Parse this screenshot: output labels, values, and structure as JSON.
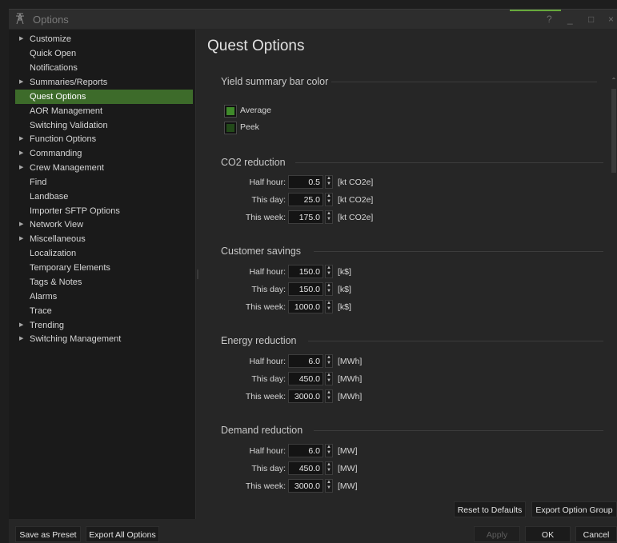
{
  "window": {
    "title": "Options",
    "controls": {
      "help": "?",
      "minimize": "_",
      "maximize": "□",
      "close": "×"
    }
  },
  "sidebar": {
    "items": [
      {
        "label": "Customize",
        "expandable": true
      },
      {
        "label": "Quick Open",
        "expandable": false
      },
      {
        "label": "Notifications",
        "expandable": false
      },
      {
        "label": "Summaries/Reports",
        "expandable": true
      },
      {
        "label": "Quest Options",
        "expandable": false,
        "selected": true
      },
      {
        "label": "AOR Management",
        "expandable": false
      },
      {
        "label": "Switching Validation",
        "expandable": false
      },
      {
        "label": "Function Options",
        "expandable": true
      },
      {
        "label": "Commanding",
        "expandable": true
      },
      {
        "label": "Crew Management",
        "expandable": true
      },
      {
        "label": "Find",
        "expandable": false
      },
      {
        "label": "Landbase",
        "expandable": false
      },
      {
        "label": "Importer SFTP Options",
        "expandable": false
      },
      {
        "label": "Network View",
        "expandable": true
      },
      {
        "label": "Miscellaneous",
        "expandable": true
      },
      {
        "label": "Localization",
        "expandable": false
      },
      {
        "label": "Temporary Elements",
        "expandable": false
      },
      {
        "label": "Tags & Notes",
        "expandable": false
      },
      {
        "label": "Alarms",
        "expandable": false
      },
      {
        "label": "Trace",
        "expandable": false
      },
      {
        "label": "Trending",
        "expandable": true
      },
      {
        "label": "Switching Management",
        "expandable": true
      }
    ],
    "arrow_glyph": "▶"
  },
  "main": {
    "title": "Quest Options",
    "yield_color": {
      "title": "Yield summary bar color",
      "options": [
        {
          "label": "Average",
          "color": "#3f8a2a"
        },
        {
          "label": "Peek",
          "color": "#234a1a"
        }
      ]
    },
    "sections": [
      {
        "title": "CO2 reduction",
        "rows": [
          {
            "label": "Half hour:",
            "value": "0.5",
            "unit": "[kt CO2e]"
          },
          {
            "label": "This day:",
            "value": "25.0",
            "unit": "[kt CO2e]"
          },
          {
            "label": "This week:",
            "value": "175.0",
            "unit": "[kt CO2e]"
          }
        ]
      },
      {
        "title": "Customer savings",
        "rows": [
          {
            "label": "Half hour:",
            "value": "150.0",
            "unit": "[k$]"
          },
          {
            "label": "This day:",
            "value": "150.0",
            "unit": "[k$]"
          },
          {
            "label": "This week:",
            "value": "1000.0",
            "unit": "[k$]"
          }
        ]
      },
      {
        "title": "Energy reduction",
        "rows": [
          {
            "label": "Half hour:",
            "value": "6.0",
            "unit": "[MWh]"
          },
          {
            "label": "This day:",
            "value": "450.0",
            "unit": "[MWh]"
          },
          {
            "label": "This week:",
            "value": "3000.0",
            "unit": "[MWh]"
          }
        ]
      },
      {
        "title": "Demand reduction",
        "rows": [
          {
            "label": "Half hour:",
            "value": "6.0",
            "unit": "[MW]"
          },
          {
            "label": "This day:",
            "value": "450.0",
            "unit": "[MW]"
          },
          {
            "label": "This week:",
            "value": "3000.0",
            "unit": "[MW]"
          }
        ]
      }
    ],
    "spinner_up": "▲",
    "spinner_down": "▼",
    "reset_label": "Reset to Defaults",
    "export_group_label": "Export Option Group"
  },
  "footer": {
    "save_preset_label": "Save as Preset",
    "export_all_label": "Export All Options",
    "apply_label": "Apply",
    "ok_label": "OK",
    "cancel_label": "Cancel"
  },
  "colors": {
    "accent": "#67a83c",
    "selection": "#3d6b2a"
  }
}
